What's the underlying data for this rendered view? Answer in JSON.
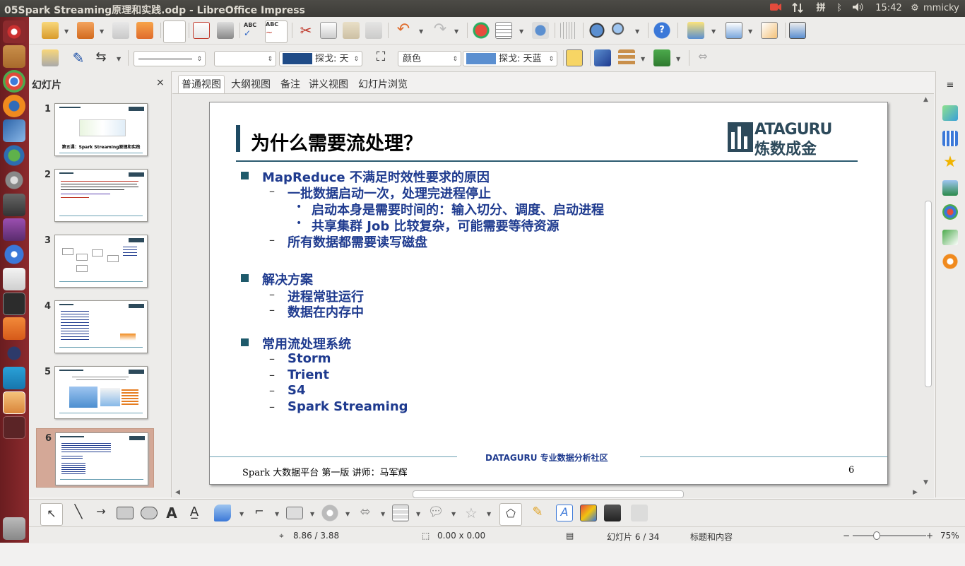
{
  "window": {
    "title": "05Spark Streaming原理和实践.odp - LibreOffice Impress"
  },
  "tray": {
    "input_method": "拼",
    "time": "15:42",
    "user": "mmicky"
  },
  "toolbar2": {
    "font_size_value": "",
    "line_color_label": "探戈: 天",
    "area_style_label": "颜色",
    "area_color_label": "探戈: 天蓝"
  },
  "slide_pane": {
    "title": "幻灯片",
    "close_label": "×",
    "thumbnails": [
      {
        "number": "1",
        "caption": "第五课：Spark Streaming原理和实践"
      },
      {
        "number": "2",
        "caption": ""
      },
      {
        "number": "3",
        "caption": ""
      },
      {
        "number": "4",
        "caption": ""
      },
      {
        "number": "5",
        "caption": ""
      },
      {
        "number": "6",
        "caption": ""
      }
    ]
  },
  "view_tabs": [
    {
      "label": "普通视图"
    },
    {
      "label": "大纲视图"
    },
    {
      "label": "备注"
    },
    {
      "label": "讲义视图"
    },
    {
      "label": "幻灯片浏览"
    }
  ],
  "slide": {
    "title": "为什么需要流处理？",
    "logo_text_top": "ATAGURU",
    "logo_text_bottom": "炼数成金",
    "sections": [
      {
        "heading": "MapReduce 不满足时效性要求的原因"
      },
      {
        "heading": "解决方案"
      },
      {
        "heading": "常用流处理系统"
      }
    ],
    "items": {
      "s1_a": "一批数据启动一次，处理完进程停止",
      "s1_a_1": "启动本身是需要时间的：输入切分、调度、启动进程",
      "s1_a_2": "共享集群 Job 比较复杂，可能需要等待资源",
      "s1_b": "所有数据都需要读写磁盘",
      "s2_a": "进程常驻运行",
      "s2_b": "数据在内存中",
      "s3_a": "Storm",
      "s3_b": "Trient",
      "s3_c": "S4",
      "s3_d": "Spark Streaming"
    },
    "footer_center": "DATAGURU 专业数据分析社区",
    "footer_left": "Spark 大数据平台 第一版 讲师：马军辉",
    "page_number": "6"
  },
  "statusbar": {
    "position": "8.86 / 3.88",
    "size": "0.00 x 0.00",
    "slide_counter": "幻灯片 6 / 34",
    "layout": "标题和内容",
    "zoom": "75%"
  }
}
